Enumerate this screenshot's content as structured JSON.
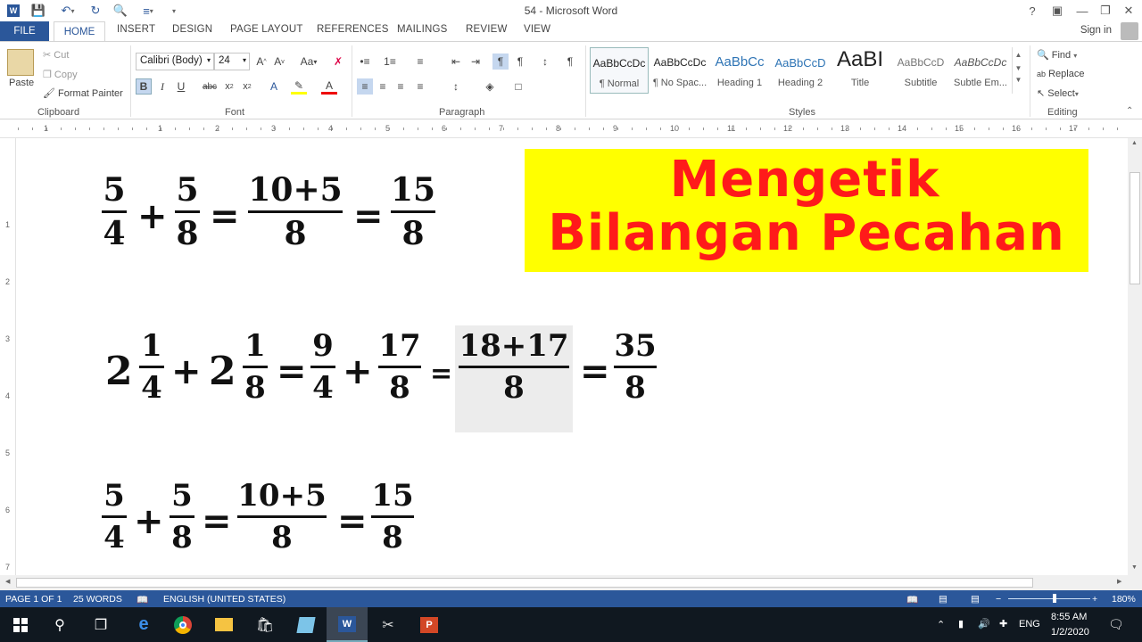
{
  "window": {
    "title": "54 - Microsoft Word"
  },
  "tabs": {
    "file": "FILE",
    "home": "HOME",
    "insert": "INSERT",
    "design": "DESIGN",
    "page_layout": "PAGE LAYOUT",
    "references": "REFERENCES",
    "mailings": "MAILINGS",
    "review": "REVIEW",
    "view": "VIEW",
    "signin": "Sign in"
  },
  "clipboard": {
    "paste": "Paste",
    "cut": "Cut",
    "copy": "Copy",
    "format_painter": "Format Painter",
    "label": "Clipboard"
  },
  "font": {
    "name": "Calibri (Body)",
    "size": "24",
    "label": "Font"
  },
  "paragraph": {
    "label": "Paragraph"
  },
  "styles": {
    "label": "Styles",
    "items": [
      {
        "sample": "AaBbCcDc",
        "name": "¶ Normal"
      },
      {
        "sample": "AaBbCcDc",
        "name": "¶ No Spac..."
      },
      {
        "sample": "AaBbCc",
        "name": "Heading 1"
      },
      {
        "sample": "AaBbCcD",
        "name": "Heading 2"
      },
      {
        "sample": "AaBI",
        "name": "Title"
      },
      {
        "sample": "AaBbCcD",
        "name": "Subtitle"
      },
      {
        "sample": "AaBbCcDc",
        "name": "Subtle Em..."
      }
    ]
  },
  "editing": {
    "find": "Find",
    "replace": "Replace",
    "select": "Select",
    "label": "Editing"
  },
  "ruler": {
    "marks": [
      "1",
      "1",
      "2",
      "3",
      "4",
      "5",
      "6",
      "7",
      "8",
      "9",
      "10",
      "11",
      "12",
      "13",
      "14",
      "15",
      "16",
      "17"
    ],
    "vmarks": [
      "1",
      "2",
      "3",
      "4",
      "5",
      "6",
      "7"
    ]
  },
  "document": {
    "banner": {
      "line1": "Mengetik",
      "line2": "Bilangan Pecahan"
    },
    "eq1": {
      "f1n": "5",
      "f1d": "4",
      "op1": "+",
      "f2n": "5",
      "f2d": "8",
      "eq1": "=",
      "f3n": "10+5",
      "f3d": "8",
      "eq2": "=",
      "f4n": "15",
      "f4d": "8"
    },
    "eq2": {
      "w1": "2",
      "f1n": "1",
      "f1d": "4",
      "op1": "+",
      "w2": "2",
      "f2n": "1",
      "f2d": "8",
      "eq1": "=",
      "f3n": "9",
      "f3d": "4",
      "op2": "+",
      "f4n": "17",
      "f4d": "8",
      "eq2": "=",
      "f5n": "18+17",
      "f5d": "8",
      "eq3": "=",
      "f6n": "35",
      "f6d": "8"
    },
    "eq3": {
      "f1n": "5",
      "f1d": "4",
      "op1": "+",
      "f2n": "5",
      "f2d": "8",
      "eq1": "=",
      "f3n": "10+5",
      "f3d": "8",
      "eq2": "=",
      "f4n": "15",
      "f4d": "8"
    }
  },
  "status": {
    "page": "PAGE 1 OF 1",
    "words": "25 WORDS",
    "language": "ENGLISH (UNITED STATES)",
    "zoom": "180%"
  },
  "taskbar": {
    "lang": "ENG",
    "time": "8:55 AM",
    "date": "1/2/2020"
  },
  "colors": {
    "accent": "#2b579a",
    "banner_bg": "#ffff00",
    "banner_text": "#ff1a1a"
  }
}
